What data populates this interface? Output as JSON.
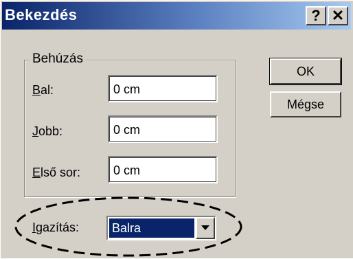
{
  "dialog": {
    "title": "Bekezdés",
    "help_glyph": "?",
    "close_glyph": "✕"
  },
  "indent_group": {
    "legend": "Behúzás",
    "left": {
      "label_mnemonic": "B",
      "label_rest": "al:",
      "value": "0 cm"
    },
    "right": {
      "label_mnemonic": "J",
      "label_rest": "obb:",
      "value": "0 cm"
    },
    "first_line": {
      "label_mnemonic": "E",
      "label_rest": "lső sor:",
      "value": "0 cm"
    }
  },
  "buttons": {
    "ok_label": "OK",
    "cancel_label": "Mégse"
  },
  "alignment": {
    "label_mnemonic": "I",
    "label_rest": "gazítás:",
    "selected": "Balra"
  },
  "colors": {
    "title_gradient_start": "#0a246a",
    "title_gradient_end": "#a6caf0",
    "dialog_face": "#d4d0c8",
    "selection": "#0a246a"
  },
  "icons": {
    "help": "question-mark-icon",
    "close": "close-x-icon",
    "dropdown": "chevron-down-icon",
    "annotation": "dashed-ellipse-highlight"
  }
}
